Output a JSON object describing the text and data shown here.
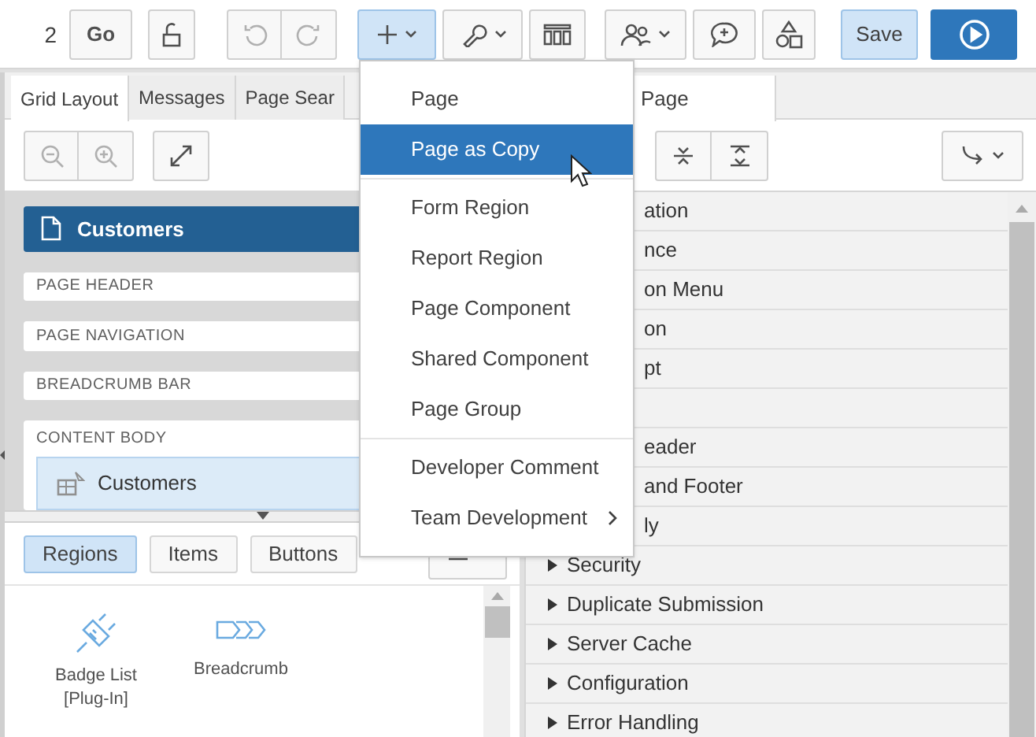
{
  "toolbar": {
    "page_number": "2",
    "go": "Go",
    "save": "Save",
    "create_active": true
  },
  "left_tabs": [
    {
      "label": "Grid Layout",
      "selected": true
    },
    {
      "label": "Messages",
      "selected": false
    },
    {
      "label": "Page Sear",
      "selected": false
    }
  ],
  "right_tabs": [
    {
      "label": "Page",
      "selected": true
    }
  ],
  "layout": {
    "page_title": "Customers",
    "sections": [
      {
        "label": "PAGE HEADER"
      },
      {
        "label": "PAGE NAVIGATION"
      },
      {
        "label": "BREADCRUMB BAR"
      },
      {
        "label": "CONTENT BODY",
        "region": "Customers"
      }
    ]
  },
  "gallery_tabs": [
    {
      "label": "Regions",
      "selected": true
    },
    {
      "label": "Items",
      "selected": false
    },
    {
      "label": "Buttons",
      "selected": false
    }
  ],
  "gallery_items": [
    {
      "label": "Badge List [Plug-In]",
      "kind": "plug"
    },
    {
      "label": "Breadcrumb",
      "kind": "breadcrumb"
    }
  ],
  "property_groups": [
    {
      "label": "ation",
      "kind": "covered"
    },
    {
      "label": "nce",
      "kind": "covered"
    },
    {
      "label": "on Menu",
      "kind": "covered"
    },
    {
      "label": "on",
      "kind": "covered"
    },
    {
      "label": "pt",
      "kind": "covered"
    },
    {
      "kind": "hidden"
    },
    {
      "label": "eader",
      "kind": "covered"
    },
    {
      "label": "and Footer",
      "kind": "covered"
    },
    {
      "label": "ly",
      "kind": "covered"
    },
    {
      "label": "Security",
      "kind": "group"
    },
    {
      "label": "Duplicate Submission",
      "kind": "group"
    },
    {
      "label": "Server Cache",
      "kind": "group"
    },
    {
      "label": "Configuration",
      "kind": "group"
    },
    {
      "label": "Error Handling",
      "kind": "group"
    }
  ],
  "create_menu": [
    {
      "items": [
        {
          "label": "Page",
          "selected": false,
          "submenu": false
        },
        {
          "label": "Page as Copy",
          "selected": true,
          "submenu": false
        }
      ]
    },
    {
      "items": [
        {
          "label": "Form Region",
          "selected": false,
          "submenu": false
        },
        {
          "label": "Report Region",
          "selected": false,
          "submenu": false
        },
        {
          "label": "Page Component",
          "selected": false,
          "submenu": false
        },
        {
          "label": "Shared Component",
          "selected": false,
          "submenu": false
        },
        {
          "label": "Page Group",
          "selected": false,
          "submenu": false
        }
      ]
    },
    {
      "items": [
        {
          "label": "Developer Comment",
          "selected": false,
          "submenu": false
        },
        {
          "label": "Team Development",
          "selected": false,
          "submenu": true
        }
      ]
    }
  ]
}
